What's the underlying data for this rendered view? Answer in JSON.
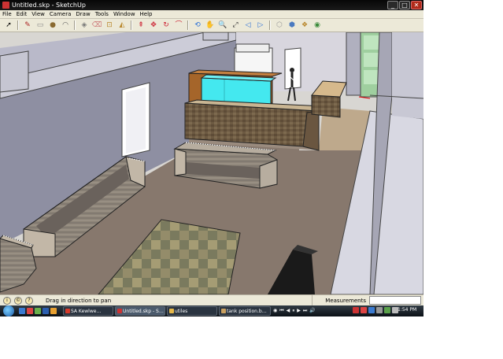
{
  "window": {
    "title": "Untitled.skp - SketchUp",
    "controls": [
      "_",
      "□",
      "✕"
    ]
  },
  "menu": {
    "items": [
      "File",
      "Edit",
      "View",
      "Camera",
      "Draw",
      "Tools",
      "Window",
      "Help"
    ]
  },
  "toolbar": {
    "tools": [
      {
        "name": "select-icon",
        "glyph": "➚"
      },
      {
        "name": "pencil-icon",
        "glyph": "✎"
      },
      {
        "name": "rectangle-icon",
        "glyph": "▭"
      },
      {
        "name": "circle-icon",
        "glyph": "●"
      },
      {
        "name": "arc-icon",
        "glyph": "◠"
      },
      {
        "name": "make-component-icon",
        "glyph": "◈"
      },
      {
        "name": "eraser-icon",
        "glyph": "⌫"
      },
      {
        "name": "tape-measure-icon",
        "glyph": "⊡"
      },
      {
        "name": "paint-bucket-icon",
        "glyph": "◭"
      },
      {
        "name": "push-pull-icon",
        "glyph": "⇞"
      },
      {
        "name": "move-icon",
        "glyph": "✥"
      },
      {
        "name": "rotate-icon",
        "glyph": "↻"
      },
      {
        "name": "offset-icon",
        "glyph": "⌒"
      },
      {
        "name": "orbit-icon",
        "glyph": "⟲"
      },
      {
        "name": "pan-icon",
        "glyph": "✋"
      },
      {
        "name": "zoom-icon",
        "glyph": "🔍"
      },
      {
        "name": "zoom-extents-icon",
        "glyph": "⤢"
      },
      {
        "name": "previous-view-icon",
        "glyph": "◁"
      },
      {
        "name": "next-view-icon",
        "glyph": "▷"
      },
      {
        "name": "get-models-icon",
        "glyph": "⬡"
      },
      {
        "name": "share-model-icon",
        "glyph": "⬢"
      },
      {
        "name": "components-icon",
        "glyph": "❖"
      },
      {
        "name": "google-earth-icon",
        "glyph": "◉"
      }
    ]
  },
  "status": {
    "hint": "Drag in direction to pan",
    "measurements_label": "Measurements",
    "measurements_value": ""
  },
  "taskbar": {
    "tasks": [
      {
        "label": "SA Kewlwe…",
        "active": false,
        "color": "#d63a2a"
      },
      {
        "label": "Untitled.skp - S…",
        "active": true,
        "color": "#c33"
      },
      {
        "label": "utiles",
        "active": false,
        "color": "#e6b84a"
      },
      {
        "label": "tank position.b…",
        "active": false,
        "color": "#c9a060"
      }
    ],
    "media": [
      "◉",
      "⏮",
      "◀",
      "⏸",
      "▶",
      "⏭",
      "🔊"
    ],
    "clock": "1:54 PM",
    "colors": {
      "accent": "#2a6fd6",
      "sketchup_red": "#c33",
      "sky": "#d8d6d2",
      "floor": "#87786d",
      "aquarium": "#44e8ef"
    }
  }
}
